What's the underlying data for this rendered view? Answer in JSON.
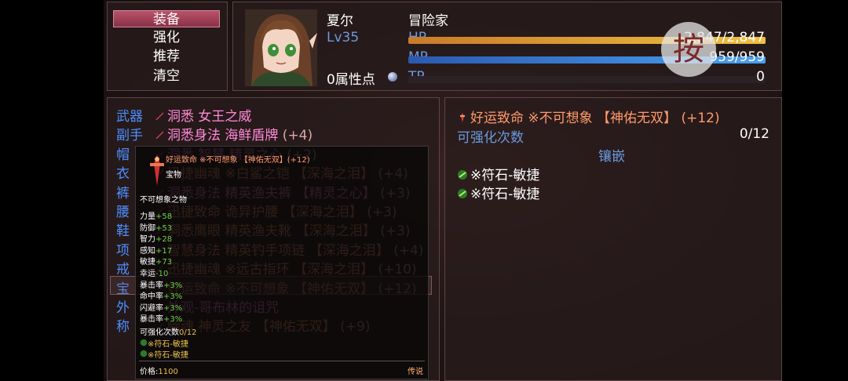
{
  "menu": [
    "装备",
    "强化",
    "推荐",
    "清空"
  ],
  "character": {
    "name": "夏尔",
    "class": "冒险家",
    "level": "Lv35",
    "attr_points": "0属性点",
    "hp_label": "HP",
    "hp_value": "2,847/2,847",
    "hp_fill": 1.0,
    "mp_label": "MP",
    "mp_value": "959/959",
    "mp_fill": 1.0,
    "tp_label": "TP",
    "tp_value": "0",
    "tp_fill": 0,
    "badge": "按"
  },
  "slots": [
    "武器",
    "副手",
    "帽",
    "衣",
    "裤",
    "腰",
    "鞋",
    "项",
    "戒",
    "宝",
    "外",
    "称"
  ],
  "equipment": [
    {
      "name": "洞悉 女王之威",
      "suffix": "",
      "color": "#ff8ad8"
    },
    {
      "name": "洞悉身法 海鲜盾牌",
      "suffix": " (+4)",
      "color": "#ff8ad8"
    },
    {
      "name": "洞悉 智慧 精灵之心",
      "suffix": " (+2)",
      "color": "#ff8ad8"
    },
    {
      "name": "迅捷幽魂 ※白鲨之铠 【深海之泪】",
      "suffix": " (+4)",
      "color": "#ff9a6a"
    },
    {
      "name": "洞悉身法 精英渔夫裤 【精灵之心】",
      "suffix": " (+3)",
      "color": "#ff8ad8"
    },
    {
      "name": "迅捷致命 诡异护腰 【深海之泪】",
      "suffix": " (+3)",
      "color": "#ff9a6a"
    },
    {
      "name": "洞悉鹰眼 精英渔夫靴 【深海之泪】",
      "suffix": " (+3)",
      "color": "#ff9a6a"
    },
    {
      "name": "智慧身法 精英钓手项链 【深海之泪】",
      "suffix": " (+4)",
      "color": "#ff9a6a"
    },
    {
      "name": "迅捷幽魂 ※远古指环 【深海之泪】",
      "suffix": " (+10)",
      "color": "#ff9a6a"
    },
    {
      "name": "好运致命 ※不可想象 【神佑无双】",
      "suffix": " (+12)",
      "color": "#ff9a6a"
    },
    {
      "name": "外观-哥布林的诅咒",
      "suffix": "",
      "color": "#ff8ad8"
    },
    {
      "name": "幽魂 神灵之友 【神佑无双】",
      "suffix": " (+9)",
      "color": "#ff9a6a"
    }
  ],
  "tooltip": {
    "title": "好运致命 ※不可想象 【神佑无双】(+12)",
    "type": "宝物",
    "desc": "不可想象之物",
    "stats": [
      {
        "k": "力量",
        "v": "+58"
      },
      {
        "k": "防御",
        "v": "+53"
      },
      {
        "k": "智力",
        "v": "+28"
      },
      {
        "k": "感知",
        "v": "+17"
      },
      {
        "k": "敏捷",
        "v": "+73"
      },
      {
        "k": "幸运",
        "v": "-10"
      },
      {
        "k": "暴击率",
        "v": "+3%"
      },
      {
        "k": "命中率",
        "v": "+3%"
      },
      {
        "k": "闪避率",
        "v": "+3%"
      },
      {
        "k": "暴击率",
        "v": "+3%"
      }
    ],
    "upg_label": "可强化次数",
    "upg_value": "0/12",
    "gems": [
      "※符石-敏捷",
      "※符石-敏捷"
    ],
    "price_label": "价格:",
    "price_value": "1100",
    "rarity": "传说"
  },
  "detail": {
    "title": "好运致命 ※不可想象 【神佑无双】 (+12)",
    "upg_label": "可强化次数",
    "upg_value": "0/12",
    "socket_header": "镶嵌",
    "gems": [
      "※符石-敏捷",
      "※符石-敏捷"
    ]
  }
}
